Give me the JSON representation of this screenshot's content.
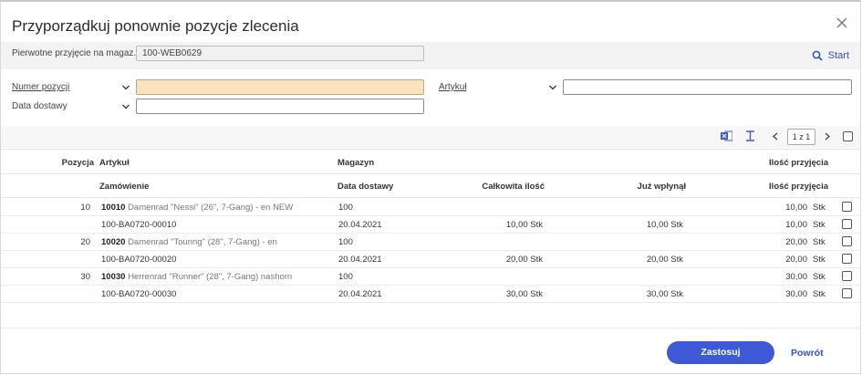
{
  "dialog": {
    "title": "Przyporządkuj ponownie pozycje zlecenia",
    "close_icon": "close-icon"
  },
  "original_receipt": {
    "label": "Pierwotne przyjęcie na magaz...",
    "value": "100-WEB0629"
  },
  "start_label": "Start",
  "filters": {
    "item_number_label": "Numer pozycji",
    "item_number_value": "",
    "delivery_date_label": "Data dostawy",
    "delivery_date_value": "",
    "article_label": "Artykuł",
    "article_value": ""
  },
  "toolbar": {
    "page_indicator": "1 z 1"
  },
  "table": {
    "headers_top": {
      "position": "Pozycja",
      "article": "Artykuł",
      "warehouse": "Magazyn",
      "receipt_qty": "Ilość przyjęcia"
    },
    "headers_bottom": {
      "order": "Zamówienie",
      "delivery_date": "Data dostawy",
      "total_qty": "Całkowita ilość",
      "already_received": "Już wpłynął",
      "receipt_qty": "Ilość przyjęcia"
    },
    "rows": [
      {
        "pos": "10",
        "code": "10010",
        "desc": "Damenrad \"Nessi\" (26\", 7-Gang) - en NEW",
        "warehouse": "100",
        "qty": "10,00",
        "unit": "Stk",
        "order": "100-BA0720-00010",
        "date": "20.04.2021",
        "total": "10,00 Stk",
        "received": "10,00 Stk",
        "qty2": "10,00",
        "unit2": "Stk"
      },
      {
        "pos": "20",
        "code": "10020",
        "desc": "Damenrad \"Touring\" (28\", 7-Gang) - en",
        "warehouse": "100",
        "qty": "20,00",
        "unit": "Stk",
        "order": "100-BA0720-00020",
        "date": "20.04.2021",
        "total": "20,00 Stk",
        "received": "20,00 Stk",
        "qty2": "20,00",
        "unit2": "Stk"
      },
      {
        "pos": "30",
        "code": "10030",
        "desc": "Herrenrad \"Runner\" (28\", 7-Gang) nashorn",
        "warehouse": "100",
        "qty": "30,00",
        "unit": "Stk",
        "order": "100-BA0720-00030",
        "date": "20.04.2021",
        "total": "30,00 Stk",
        "received": "30,00 Stk",
        "qty2": "30,00",
        "unit2": "Stk"
      }
    ]
  },
  "footer": {
    "apply_label": "Zastosuj",
    "back_label": "Powrót"
  },
  "colors": {
    "accent": "#3e59d6",
    "highlight_input": "#fde3bd"
  }
}
